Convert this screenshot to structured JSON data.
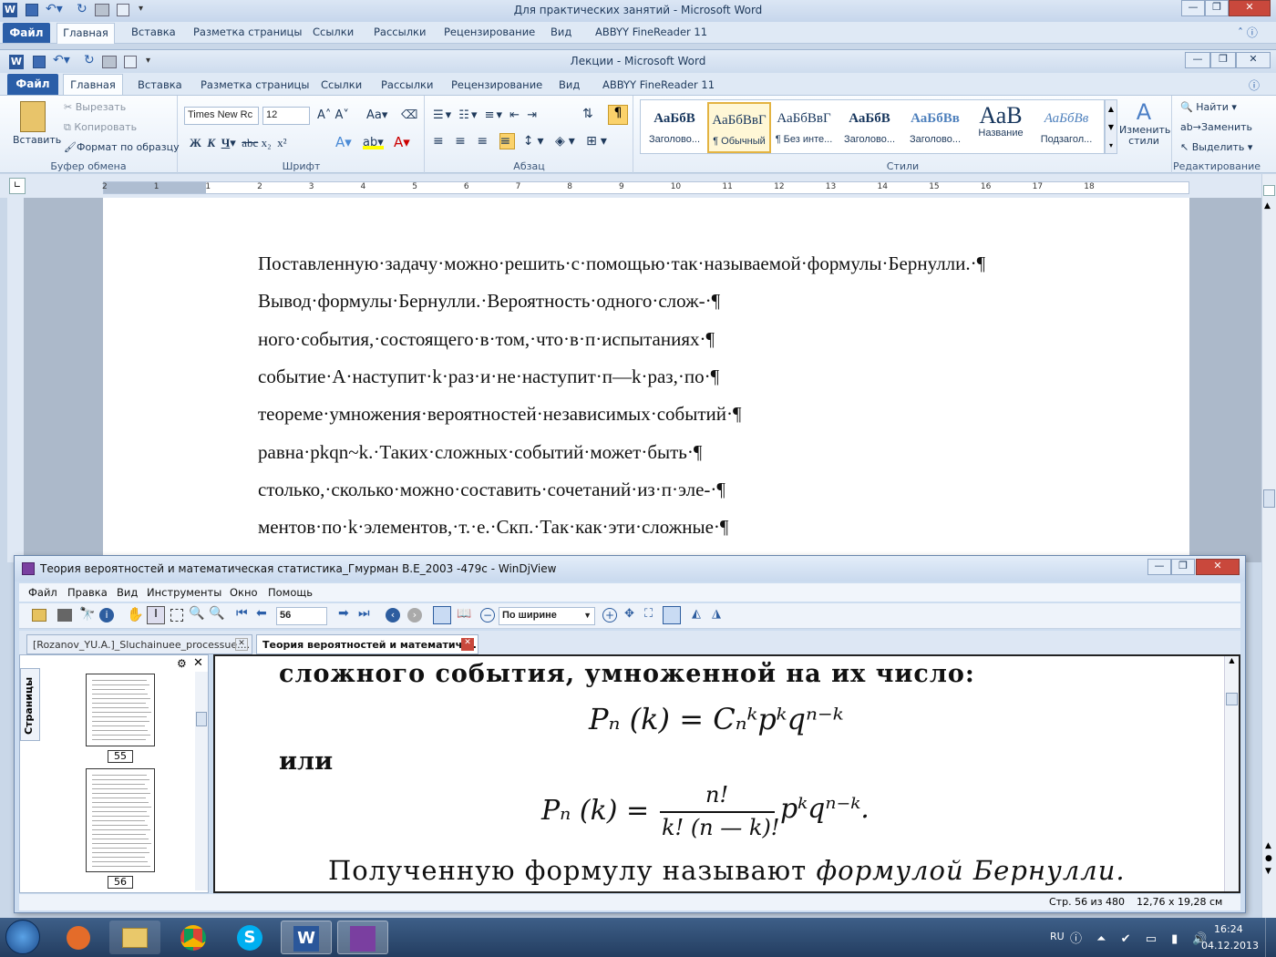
{
  "outer_window": {
    "title": "Для практических занятий  -  Microsoft Word",
    "tabs": {
      "file": "Файл",
      "home": "Главная",
      "insert": "Вставка",
      "layout": "Разметка страницы",
      "refs": "Ссылки",
      "mail": "Рассылки",
      "review": "Рецензирование",
      "view": "Вид",
      "abbyy": "ABBYY FineReader 11"
    }
  },
  "inner_window": {
    "title": "Лекции  -  Microsoft Word",
    "tabs": {
      "file": "Файл",
      "home": "Главная",
      "insert": "Вставка",
      "layout": "Разметка страницы",
      "refs": "Ссылки",
      "mail": "Рассылки",
      "review": "Рецензирование",
      "view": "Вид",
      "abbyy": "ABBYY FineReader 11"
    }
  },
  "ribbon": {
    "clipboard": {
      "paste": "Вставить",
      "cut": "Вырезать",
      "copy": "Копировать",
      "format": "Формат по образцу",
      "label": "Буфер обмена"
    },
    "font": {
      "name": "Times New Rc",
      "size": "12",
      "label": "Шрифт"
    },
    "paragraph": {
      "label": "Абзац"
    },
    "styles": {
      "label": "Стили",
      "items": [
        {
          "preview": "АаБбВ",
          "name": "Заголово..."
        },
        {
          "preview": "АаБбВвГ",
          "name": "¶ Обычный"
        },
        {
          "preview": "АаБбВвГ",
          "name": "¶ Без инте..."
        },
        {
          "preview": "АаБбВ",
          "name": "Заголово..."
        },
        {
          "preview": "АаБбВв",
          "name": "Заголово..."
        },
        {
          "preview": "АаВ",
          "name": "Название"
        },
        {
          "preview": "АаБбВв",
          "name": "Подзагол..."
        }
      ],
      "change": "Изменить стили"
    },
    "editing": {
      "label": "Редактирование",
      "find": "Найти",
      "replace": "Заменить",
      "select": "Выделить"
    }
  },
  "ruler": {
    "numbers": [
      "2",
      "1",
      "1",
      "2",
      "3",
      "4",
      "5",
      "6",
      "7",
      "8",
      "9",
      "10",
      "11",
      "12",
      "13",
      "14",
      "15",
      "16",
      "17",
      "18"
    ]
  },
  "document": {
    "lines": [
      "Поставленную·задачу·можно·решить·с·помощью·так·называемой·формулы·Бернулли.·¶",
      "Вывод·формулы·Бернулли.·Вероятность·одного·слож-·¶",
      "ного·события,·состоящего·в·том,·что·в·п·испытаниях·¶",
      "событие·А·наступит·k·раз·и·не·наступит·п—k·раз,·по·¶",
      "теореме·умножения·вероятностей·независимых·событий·¶",
      "равна·pkqn~k.·Таких·сложных·событий·может·быть·¶",
      "столько,·сколько·можно·составить·сочетаний·из·п·эле-·¶",
      "ментов·по·k·элементов,·т.·е.·Скп.·Так·как·эти·сложные·¶"
    ]
  },
  "djview": {
    "title": "Теория вероятностей и математическая статистика_Гмурман В.Е_2003 -479с - WinDjView",
    "menu": [
      "Файл",
      "Правка",
      "Вид",
      "Инструменты",
      "Окно",
      "Помощь"
    ],
    "page_field": "56",
    "zoom_field": "По ширине",
    "tabs": [
      "[Rozanov_YU.A.]_Sluchainuee_processue....",
      "Теория вероятностей и математиче..."
    ],
    "sidebar_label": "Страницы",
    "thumbs": [
      "55",
      "56"
    ],
    "scan": {
      "line1": "сложного  события,  умноженной  на  их  число:",
      "formula1": "Pₙ (k) = Cₙᵏpᵏqⁿ⁻ᵏ",
      "or": "или",
      "formula2_left": "Pₙ (k) =",
      "formula2_num": "n!",
      "formula2_den": "k! (n — k)!",
      "formula2_right": "pᵏqⁿ⁻ᵏ.",
      "line_last_a": "Полученную  формулу  называют ",
      "line_last_b": "формулой  Бернулли."
    },
    "status": {
      "page": "Стр. 56 из 480",
      "size": "12,76 x 19,28 см"
    }
  },
  "taskbar": {
    "lang": "RU",
    "time": "16:24",
    "date": "04.12.2013"
  }
}
